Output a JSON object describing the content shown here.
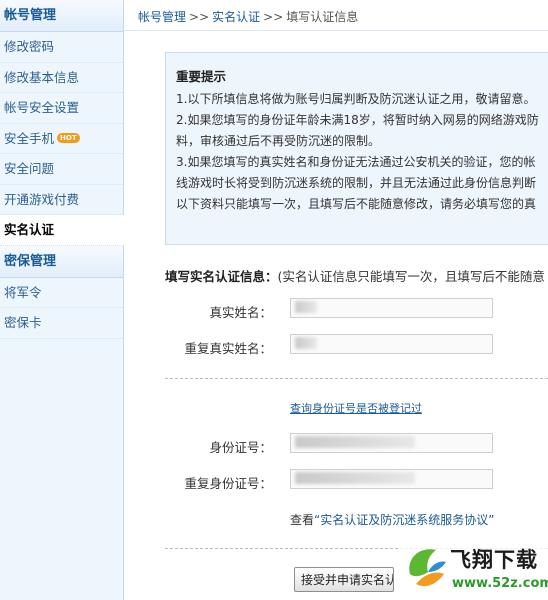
{
  "sidebar": {
    "section1": "帐号管理",
    "items1": [
      {
        "label": "修改密码"
      },
      {
        "label": "修改基本信息"
      },
      {
        "label": "帐号安全设置"
      },
      {
        "label": "安全手机",
        "badge": "HOT"
      },
      {
        "label": "安全问题"
      },
      {
        "label": "开通游戏付费"
      },
      {
        "label": "实名认证"
      }
    ],
    "section2": "密保管理",
    "items2": [
      {
        "label": "将军令"
      },
      {
        "label": "密保卡"
      }
    ]
  },
  "breadcrumb": {
    "item1": "帐号管理",
    "sep": ">>",
    "item2": "实名认证",
    "item3": "填写认证信息"
  },
  "notice": {
    "title": "重要提示",
    "lines": [
      "1.以下所填信息将做为账号归属判断及防沉迷认证之用，敬请留意。",
      "2.如果您填写的身份证年龄未满18岁，将暂时纳入网易的网络游戏防",
      "料，审核通过后不再受防沉迷的限制。",
      "3.如果您填写的真实姓名和身份证无法通过公安机关的验证，您的帐",
      "线游戏时长将受到防沉迷系统的限制，并且无法通过此身份信息判断",
      "以下资料只能填写一次，且填写后不能随意修改，请务必填写您的真"
    ]
  },
  "form": {
    "title": "填写实名认证信息：",
    "title_note": "(实名认证信息只能填写一次，且填写后不能随意",
    "real_name_label": "真实姓名：",
    "repeat_real_name_label": "重复真实姓名：",
    "check_link": "查询身份证号是否被登记过",
    "id_label": "身份证号：",
    "repeat_id_label": "重复身份证号：",
    "agreement_prefix": "查看",
    "agreement_link": "“实名认证及防沉迷系统服务协议”",
    "submit": "接受并申请实名认证"
  },
  "watermark": {
    "name": "飞翔下载",
    "url": "www.52z.com"
  }
}
